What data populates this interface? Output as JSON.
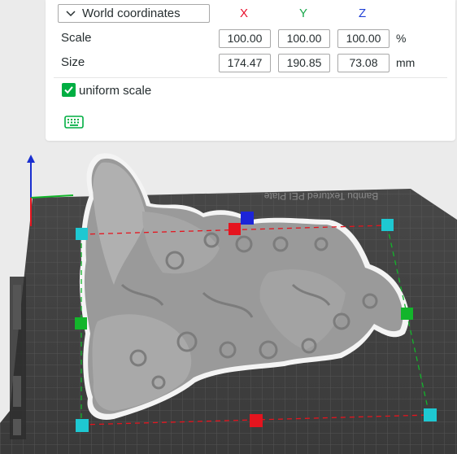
{
  "scale_panel": {
    "coordinate_mode": "World coordinates",
    "axes": {
      "x": "X",
      "y": "Y",
      "z": "Z"
    },
    "scale": {
      "label": "Scale",
      "x": "100.00",
      "y": "100.00",
      "z": "100.00",
      "unit": "%"
    },
    "size": {
      "label": "Size",
      "x": "174.47",
      "y": "190.85",
      "z": "73.08",
      "unit": "mm"
    },
    "uniform_scale": {
      "label": "uniform scale",
      "checked": true
    },
    "keyboard_icon": "keyboard-icon"
  },
  "viewport": {
    "plate_label": "Bambu Textured PEI Plate",
    "model": "dragon-butterfly-model",
    "handle_colors": {
      "corner": "#1ec8d2",
      "mid_x": "#e5141e",
      "mid_y": "#13b52b",
      "top": "#1c24d8"
    }
  }
}
